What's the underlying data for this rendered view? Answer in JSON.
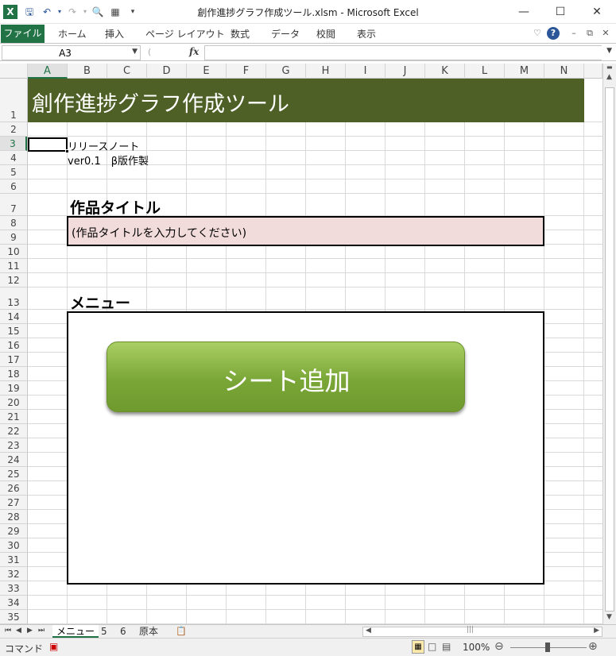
{
  "window": {
    "title": "創作進捗グラフ作成ツール.xlsm  -  Microsoft Excel",
    "minimize": "—",
    "maximize": "☐",
    "close": "✕"
  },
  "ribbon": {
    "file_tab": "ファイル",
    "tabs": [
      "ホーム",
      "挿入",
      "ページ レイアウト",
      "数式",
      "データ",
      "校閲",
      "表示"
    ]
  },
  "formula_bar": {
    "name_box": "A3",
    "fx": "fx",
    "formula": ""
  },
  "columns": [
    "A",
    "B",
    "C",
    "D",
    "E",
    "F",
    "G",
    "H",
    "I",
    "J",
    "K",
    "L",
    "M",
    "N"
  ],
  "selected_column": "A",
  "selected_row": "3",
  "rows": [
    "1",
    "2",
    "3",
    "4",
    "5",
    "6",
    "7",
    "8",
    "9",
    "10",
    "11",
    "12",
    "13",
    "14",
    "15",
    "16",
    "17",
    "18",
    "19",
    "20",
    "21",
    "22",
    "23",
    "24",
    "25",
    "26",
    "27",
    "28",
    "29",
    "30",
    "31",
    "32",
    "33",
    "34",
    "35"
  ],
  "sheet": {
    "banner_title": "創作進捗グラフ作成ツール",
    "release_note_label": "リリースノート",
    "version_note": "ver0.1　β版作製",
    "work_title_heading": "作品タイトル",
    "work_title_placeholder": "(作品タイトルを入力してください)",
    "menu_heading": "メニュー",
    "add_sheet_button": "シート追加"
  },
  "sheet_tabs": [
    "メニュー",
    "5",
    "6",
    "原本"
  ],
  "active_sheet": "メニュー",
  "status": {
    "mode": "コマンド",
    "zoom": "100%"
  },
  "colors": {
    "excel_green": "#217346",
    "banner": "#4e6026",
    "title_input_fill": "#f2dcdb",
    "button_green": "#7aa637"
  }
}
